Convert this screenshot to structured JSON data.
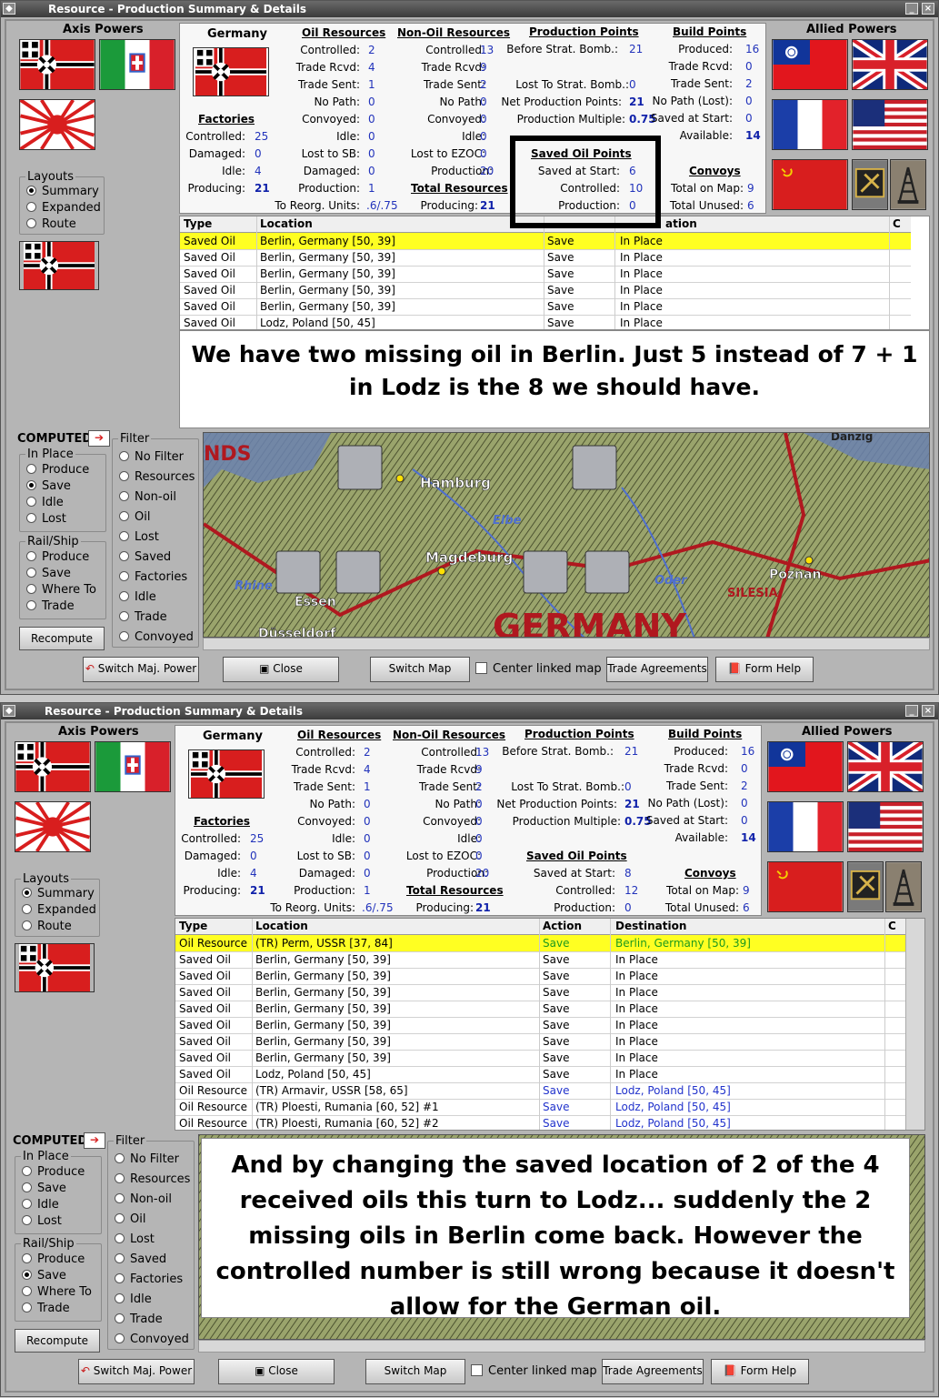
{
  "window_title": "Resource - Production Summary & Details",
  "axis_label": "Axis Powers",
  "allied_label": "Allied Powers",
  "country": "Germany",
  "factories": {
    "header": "Factories",
    "controlled_l": "Controlled:",
    "controlled_v": "25",
    "damaged_l": "Damaged:",
    "damaged_v": "0",
    "idle_l": "Idle:",
    "idle_v": "4",
    "producing_l": "Producing:",
    "producing_v": "21"
  },
  "oil": {
    "header": "Oil Resources",
    "controlled_l": "Controlled:",
    "controlled_v": "2",
    "rcvd_l": "Trade Rcvd:",
    "rcvd_v": "4",
    "sent_l": "Trade Sent:",
    "sent_v": "1",
    "nopath_l": "No Path:",
    "nopath_v": "0",
    "convoyed_l": "Convoyed:",
    "convoyed_v": "0",
    "idle_l": "Idle:",
    "idle_v": "0",
    "lost_l": "Lost to SB:",
    "lost_v": "0",
    "damaged_l": "Damaged:",
    "damaged_v": "0",
    "production_l": "Production:",
    "production_v": "1",
    "reorg_l": "To Reorg. Units:",
    "reorg_v": ".6/.75"
  },
  "nonoil": {
    "header": "Non-Oil Resources",
    "controlled_l": "Controlled:",
    "controlled_v": "13",
    "rcvd_l": "Trade Rcvd:",
    "rcvd_v": "9",
    "sent_l": "Trade Sent:",
    "sent_v": "2",
    "nopath_l": "No Path:",
    "nopath_v": "0",
    "convoyed_l": "Convoyed:",
    "convoyed_v": "0",
    "idle_l": "Idle:",
    "idle_v": "0",
    "lost_l": "Lost to EZOC:",
    "lost_v": "0",
    "production_l": "Production:",
    "production_v": "20"
  },
  "total": {
    "header": "Total Resources",
    "producing_l": "Producing:",
    "producing_v": "21"
  },
  "pp": {
    "header": "Production Points",
    "before_l": "Before Strat. Bomb.:",
    "before_v": "21",
    "lost_l": "Lost To Strat. Bomb.:",
    "lost_v": "0",
    "net_l": "Net Production Points:",
    "net_v": "21",
    "mult_l": "Production Multiple:",
    "mult_v": "0.75"
  },
  "bp": {
    "header": "Build Points",
    "produced_l": "Produced:",
    "produced_v": "16",
    "rcvd_l": "Trade Rcvd:",
    "rcvd_v": "0",
    "sent_l": "Trade Sent:",
    "sent_v": "2",
    "nopath_l": "No Path (Lost):",
    "nopath_v": "0",
    "saved_l": "Saved at Start:",
    "saved_v": "0",
    "avail_l": "Available:",
    "avail_v": "14"
  },
  "convoys": {
    "header": "Convoys",
    "total_l": "Total on Map:",
    "total_v": "9",
    "unused_l": "Total Unused:",
    "unused_v": "6"
  },
  "sop_header": "Saved Oil Points",
  "sop_saved_l": "Saved at Start:",
  "sop_ctrl_l": "Controlled:",
  "sop_prod_l": "Production:",
  "sop1": {
    "saved_v": "6",
    "ctrl_v": "10",
    "prod_v": "0"
  },
  "sop2": {
    "saved_v": "8",
    "ctrl_v": "12",
    "prod_v": "0"
  },
  "layouts": {
    "legend": "Layouts",
    "summary": "Summary",
    "expanded": "Expanded",
    "route": "Route"
  },
  "computed": "COMPUTED",
  "inplace": {
    "legend": "In Place",
    "produce": "Produce",
    "save": "Save",
    "idle": "Idle",
    "lost": "Lost"
  },
  "railship": {
    "legend": "Rail/Ship",
    "produce": "Produce",
    "save": "Save",
    "whereto": "Where To",
    "trade": "Trade"
  },
  "filter": {
    "legend": "Filter",
    "nofilter": "No Filter",
    "resources": "Resources",
    "nonoil": "Non-oil",
    "oil": "Oil",
    "lost": "Lost",
    "saved": "Saved",
    "factories": "Factories",
    "idle": "Idle",
    "trade": "Trade",
    "convoyed": "Convoyed"
  },
  "recompute": "Recompute",
  "buttons": {
    "switch_power": "Switch Maj. Power",
    "close": "Close",
    "switch_map": "Switch Map",
    "center": "Center linked map",
    "trade": "Trade Agreements",
    "help": "Form Help"
  },
  "columns": {
    "type": "Type",
    "location": "Location",
    "action": "Action",
    "destination": "Destination",
    "c": "C"
  },
  "col_tail": "ation",
  "rows1": [
    [
      "Saved Oil",
      "Berlin, Germany [50, 39]",
      "Save",
      "In Place"
    ],
    [
      "Saved Oil",
      "Berlin, Germany [50, 39]",
      "Save",
      "In Place"
    ],
    [
      "Saved Oil",
      "Berlin, Germany [50, 39]",
      "Save",
      "In Place"
    ],
    [
      "Saved Oil",
      "Berlin, Germany [50, 39]",
      "Save",
      "In Place"
    ],
    [
      "Saved Oil",
      "Berlin, Germany [50, 39]",
      "Save",
      "In Place"
    ],
    [
      "Saved Oil",
      "Lodz, Poland [50, 45]",
      "Save",
      "In Place"
    ]
  ],
  "rows2": [
    [
      "Oil Resource",
      "(TR) Perm, USSR [37, 84]",
      "Save",
      "Berlin, Germany [50, 39]"
    ],
    [
      "Saved Oil",
      "Berlin, Germany [50, 39]",
      "Save",
      "In Place"
    ],
    [
      "Saved Oil",
      "Berlin, Germany [50, 39]",
      "Save",
      "In Place"
    ],
    [
      "Saved Oil",
      "Berlin, Germany [50, 39]",
      "Save",
      "In Place"
    ],
    [
      "Saved Oil",
      "Berlin, Germany [50, 39]",
      "Save",
      "In Place"
    ],
    [
      "Saved Oil",
      "Berlin, Germany [50, 39]",
      "Save",
      "In Place"
    ],
    [
      "Saved Oil",
      "Berlin, Germany [50, 39]",
      "Save",
      "In Place"
    ],
    [
      "Saved Oil",
      "Berlin, Germany [50, 39]",
      "Save",
      "In Place"
    ],
    [
      "Saved Oil",
      "Lodz, Poland [50, 45]",
      "Save",
      "In Place"
    ],
    [
      "Oil Resource",
      "(TR) Armavir, USSR [58, 65]",
      "Save",
      "Lodz, Poland [50, 45]"
    ],
    [
      "Oil Resource",
      "(TR) Ploesti, Rumania [60, 52] #1",
      "Save",
      "Lodz, Poland [50, 45]"
    ],
    [
      "Oil Resource",
      "(TR) Ploesti, Rumania [60, 52] #2",
      "Save",
      "Lodz, Poland [50, 45]"
    ]
  ],
  "caption1": "We have two missing oil in Berlin. Just 5 instead of 7 + 1 in Lodz is the 8 we should have.",
  "caption2": "And by changing the saved location of 2 of the 4 received oils this turn to Lodz... suddenly the 2 missing oils in Berlin come back. However the controlled number is still wrong because it doesn't allow for the German oil.",
  "map_labels": {
    "germany": "GERMANY",
    "hamburg": "Hamburg",
    "magdeburg": "Magdeburg",
    "essen": "Essen",
    "dusseldorf": "Düsseldorf",
    "poznan": "Poznan",
    "silesia": "SILESIA",
    "elbe": "Elbe",
    "oder": "Oder",
    "rhine": "Rhine",
    "nds": "NDS",
    "danzig": "Danzig"
  },
  "colors": {
    "selected_row": "#ffff22",
    "value_blue": "#2233bb",
    "route_green": "#1d9a1d",
    "map_border_red": "#b0181f"
  }
}
